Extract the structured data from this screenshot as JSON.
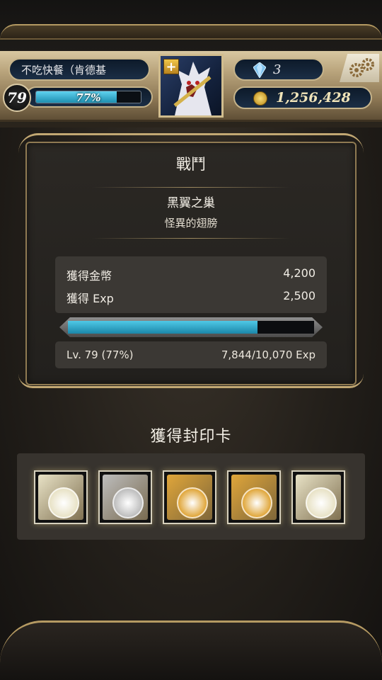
{
  "header": {
    "player_name": "不吃快餐（肯德基",
    "level": "79",
    "xp_percent_label": "77%",
    "xp_fraction": 0.77,
    "gems": "3",
    "coins": "1,256,428"
  },
  "battle": {
    "title": "戰鬥",
    "stage_name": "黑翼之巢",
    "stage_subtitle": "怪異的翅膀",
    "rewards": [
      {
        "label": "獲得金幣",
        "value": "4,200"
      },
      {
        "label": "獲得 Exp",
        "value": "2,500"
      }
    ],
    "exp_fraction": 0.77,
    "level_text": "Lv. 79 (77%)",
    "exp_text": "7,844/10,070 Exp"
  },
  "cards": {
    "title": "獲得封印卡",
    "items": [
      {
        "rarity": "silver-gold",
        "color": "#e8e2c6"
      },
      {
        "rarity": "silver",
        "color": "#bdbdbd"
      },
      {
        "rarity": "gold",
        "color": "#e0a63a"
      },
      {
        "rarity": "gold",
        "color": "#e0a63a"
      },
      {
        "rarity": "silver-gold",
        "color": "#e8e2c6"
      }
    ]
  },
  "colors": {
    "accent_blue": "#3fb8d8",
    "gold_trim": "#c2a873"
  }
}
